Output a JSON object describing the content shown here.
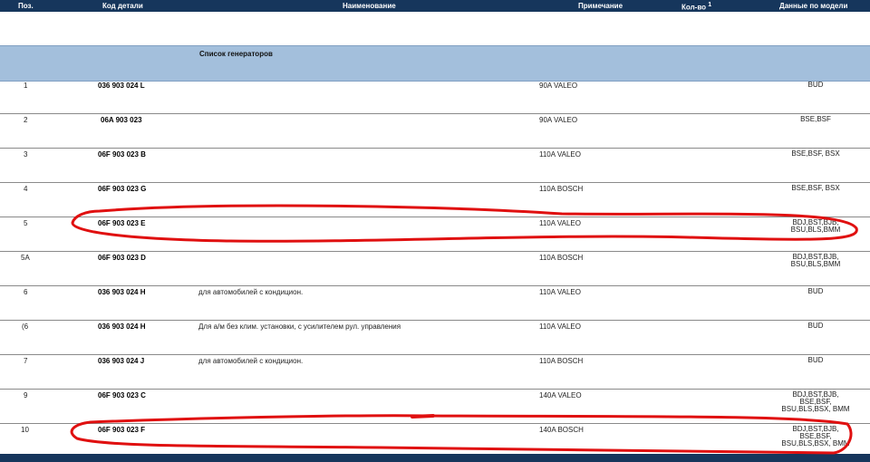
{
  "header": {
    "pos": "Поз.",
    "code": "Код детали",
    "name": "Наименование",
    "note": "Примечание",
    "qty": "Кол-во",
    "qty_sup": "1",
    "model": "Данные по модели"
  },
  "section_title": "Список генераторов",
  "rows": [
    {
      "pos": "1",
      "code": "036 903 024 L",
      "name": "",
      "note": "90A VALEO",
      "model": "BUD"
    },
    {
      "pos": "2",
      "code": "06A 903 023",
      "name": "",
      "note": "90A VALEO",
      "model": "BSE,BSF"
    },
    {
      "pos": "3",
      "code": "06F 903 023 B",
      "name": "",
      "note": "110A VALEO",
      "model": "BSE,BSF, BSX"
    },
    {
      "pos": "4",
      "code": "06F 903 023 G",
      "name": "",
      "note": "110A BOSCH",
      "model": "BSE,BSF, BSX"
    },
    {
      "pos": "5",
      "code": "06F 903 023 E",
      "name": "",
      "note": "110A VALEO",
      "model": "BDJ,BST,BJB, BSU,BLS,BMM"
    },
    {
      "pos": "5A",
      "code": "06F 903 023 D",
      "name": "",
      "note": "110A BOSCH",
      "model": "BDJ,BST,BJB, BSU,BLS,BMM"
    },
    {
      "pos": "6",
      "code": "036 903 024 H",
      "name": "для автомобилей с кондицион.",
      "note": "110A VALEO",
      "model": "BUD"
    },
    {
      "pos": "(6",
      "code": "036 903 024 H",
      "name": "Для а/м без клим. установки, с усилителем рул. управления",
      "note": "110A VALEO",
      "model": "BUD"
    },
    {
      "pos": "7",
      "code": "036 903 024 J",
      "name": "для автомобилей с кондицион.",
      "note": "110A BOSCH",
      "model": "BUD"
    },
    {
      "pos": "9",
      "code": "06F 903 023 C",
      "name": "",
      "note": "140A VALEO",
      "model": "BDJ,BST,BJB, BSE,BSF, BSU,BLS,BSX, BMM"
    },
    {
      "pos": "10",
      "code": "06F 903 023 F",
      "name": "",
      "note": "140A BOSCH",
      "model": "BDJ,BST,BJB, BSE,BSF, BSU,BLS,BSX, BMM"
    }
  ],
  "colors": {
    "header_bg": "#16365c",
    "section_bg": "#a3bfdc",
    "highlight_stroke": "#e01010"
  }
}
